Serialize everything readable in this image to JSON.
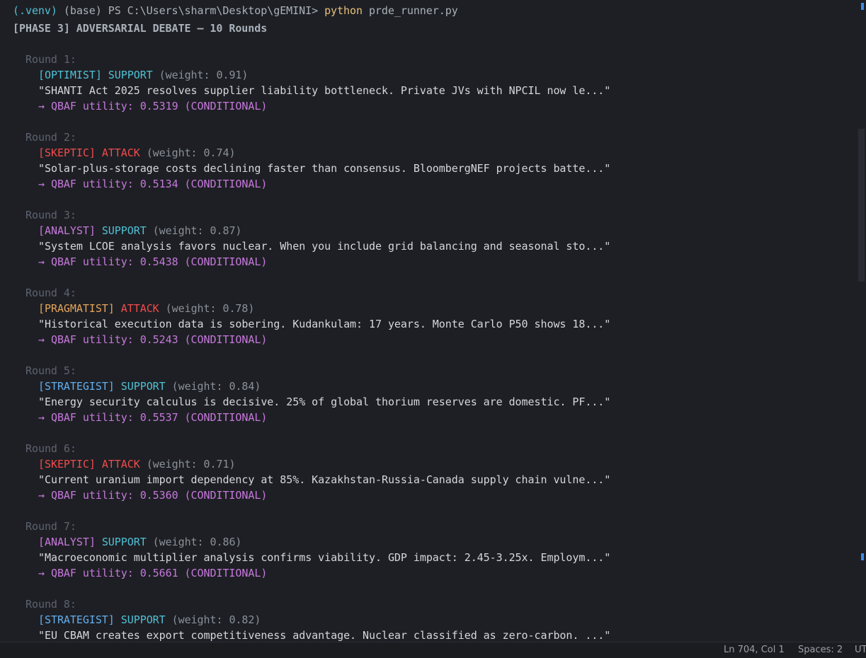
{
  "prompt": {
    "venv": "(.venv)",
    "env_path": " (base) PS C:\\Users\\sharm\\Desktop\\gEMINI>",
    "command": "python",
    "args": "prde_runner.py"
  },
  "phase_header": "[PHASE 3] ADVERSARIAL DEBATE — 10 Rounds",
  "rounds": [
    {
      "label": "Round 1:",
      "agent": "[OPTIMIST]",
      "agent_color": "#4fc1d6",
      "stance": "SUPPORT",
      "stance_color": "#4fc1d6",
      "weight": "(weight: 0.91)",
      "quote": "\"SHANTI Act 2025 resolves supplier liability bottleneck. Private JVs with NPCIL now le...\"",
      "qbaf": "→ QBAF utility: 0.5319 (CONDITIONAL)"
    },
    {
      "label": "Round 2:",
      "agent": "[SKEPTIC]",
      "agent_color": "#f14c4c",
      "stance": "ATTACK",
      "stance_color": "#f14c4c",
      "weight": "(weight: 0.74)",
      "quote": "\"Solar-plus-storage costs declining faster than consensus. BloombergNEF projects batte...\"",
      "qbaf": "→ QBAF utility: 0.5134 (CONDITIONAL)"
    },
    {
      "label": "Round 3:",
      "agent": "[ANALYST]",
      "agent_color": "#c678dd",
      "stance": "SUPPORT",
      "stance_color": "#4fc1d6",
      "weight": "(weight: 0.87)",
      "quote": "\"System LCOE analysis favors nuclear. When you include grid balancing and seasonal sto...\"",
      "qbaf": "→ QBAF utility: 0.5438 (CONDITIONAL)"
    },
    {
      "label": "Round 4:",
      "agent": "[PRAGMATIST]",
      "agent_color": "#e5a55b",
      "stance": "ATTACK",
      "stance_color": "#f14c4c",
      "weight": "(weight: 0.78)",
      "quote": "\"Historical execution data is sobering. Kudankulam: 17 years. Monte Carlo P50 shows 18...\"",
      "qbaf": "→ QBAF utility: 0.5243 (CONDITIONAL)"
    },
    {
      "label": "Round 5:",
      "agent": "[STRATEGIST]",
      "agent_color": "#61afef",
      "stance": "SUPPORT",
      "stance_color": "#4fc1d6",
      "weight": "(weight: 0.84)",
      "quote": "\"Energy security calculus is decisive. 25% of global thorium reserves are domestic. PF...\"",
      "qbaf": "→ QBAF utility: 0.5537 (CONDITIONAL)"
    },
    {
      "label": "Round 6:",
      "agent": "[SKEPTIC]",
      "agent_color": "#f14c4c",
      "stance": "ATTACK",
      "stance_color": "#f14c4c",
      "weight": "(weight: 0.71)",
      "quote": "\"Current uranium import dependency at 85%. Kazakhstan-Russia-Canada supply chain vulne...\"",
      "qbaf": "→ QBAF utility: 0.5360 (CONDITIONAL)"
    },
    {
      "label": "Round 7:",
      "agent": "[ANALYST]",
      "agent_color": "#c678dd",
      "stance": "SUPPORT",
      "stance_color": "#4fc1d6",
      "weight": "(weight: 0.86)",
      "quote": "\"Macroeconomic multiplier analysis confirms viability. GDP impact: 2.45-3.25x. Employm...\"",
      "qbaf": "→ QBAF utility: 0.5661 (CONDITIONAL)"
    },
    {
      "label": "Round 8:",
      "agent": "[STRATEGIST]",
      "agent_color": "#61afef",
      "stance": "SUPPORT",
      "stance_color": "#4fc1d6",
      "weight": "(weight: 0.82)",
      "quote": "\"EU CBAM creates export competitiveness advantage. Nuclear classified as zero-carbon. ...\""
    }
  ],
  "status": {
    "position": "Ln 704, Col 1",
    "spaces": "Spaces: 2",
    "encoding": "UT"
  }
}
